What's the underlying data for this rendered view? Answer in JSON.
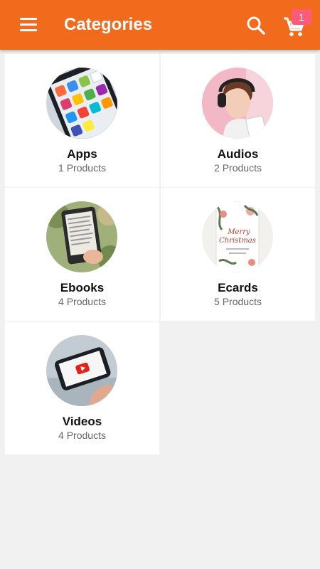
{
  "header": {
    "title": "Categories",
    "cart_count": "1",
    "background_color": "#f26b1d",
    "icons": [
      "menu-icon",
      "search-icon",
      "cart-icon"
    ]
  },
  "categories": [
    {
      "name": "Apps",
      "count": "1 Products",
      "image": "smartphone-app-icons"
    },
    {
      "name": "Audios",
      "count": "2 Products",
      "image": "woman-with-headphones"
    },
    {
      "name": "Ebooks",
      "count": "4 Products",
      "image": "ereader-in-hand"
    },
    {
      "name": "Ecards",
      "count": "5 Products",
      "image": "merry-christmas-card"
    },
    {
      "name": "Videos",
      "count": "4 Products",
      "image": "phone-playing-video"
    }
  ]
}
